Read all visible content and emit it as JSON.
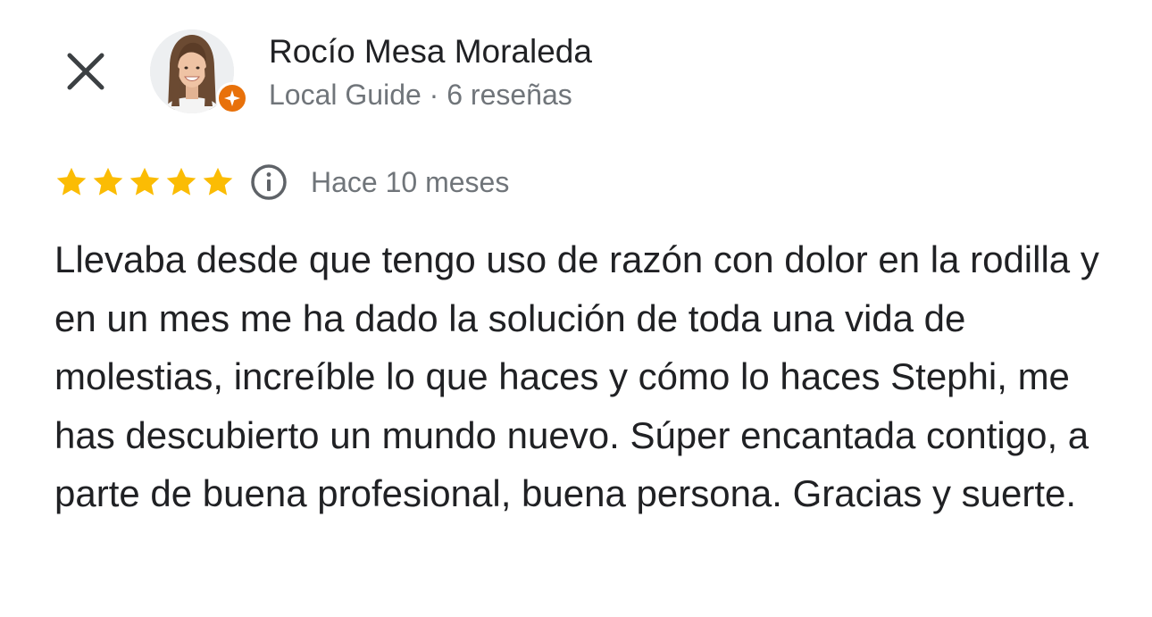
{
  "author": {
    "name": "Rocío Mesa Moraleda",
    "badge_label": "Local Guide",
    "separator": "·",
    "review_count": "6 reseñas"
  },
  "review": {
    "rating": 5,
    "max_rating": 5,
    "date": "Hace 10 meses",
    "text": "Llevaba desde que tengo uso de razón con dolor en la rodilla y en un mes me ha dado la solución de toda una vida de molestias, increíble lo que haces y cómo lo haces Stephi, me has descubierto un mundo nuevo. Súper encantada contigo, a parte de buena profesional, buena persona. Gracias y suerte."
  },
  "icons": {
    "close": "close-icon",
    "star": "star-icon",
    "info": "info-icon",
    "local_guide_badge": "local-guide-badge-icon"
  },
  "colors": {
    "star": "#fbbc04",
    "badge": "#e8710a",
    "text_primary": "#202124",
    "text_secondary": "#70757a"
  }
}
